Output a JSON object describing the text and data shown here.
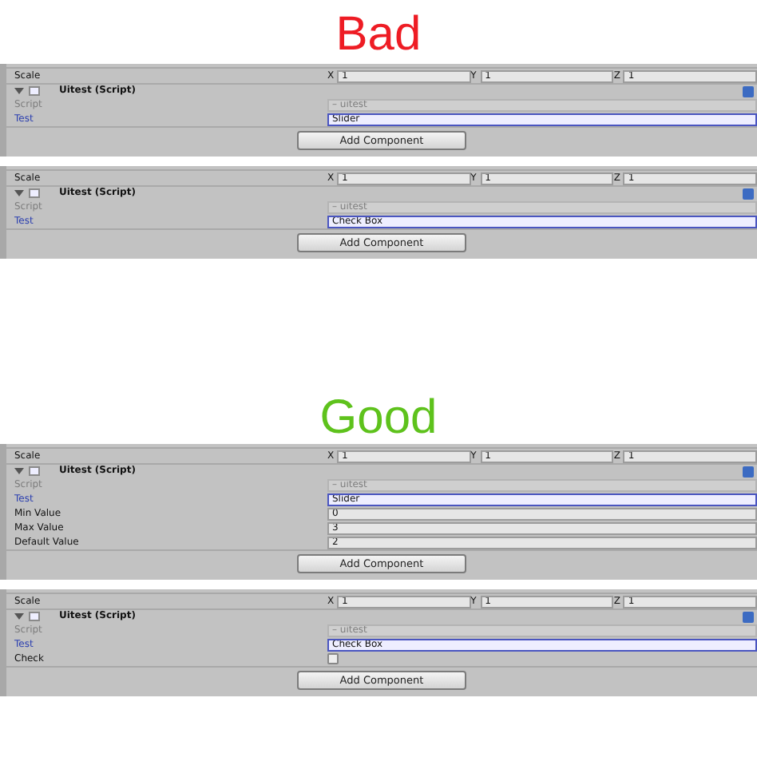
{
  "sections": [
    {
      "heading": "Bad",
      "color": "#ee1c24",
      "panels": [
        {
          "scale": {
            "label": "Scale",
            "fields": [
              {
                "axis": "X",
                "value": "1"
              },
              {
                "axis": "Y",
                "value": "1"
              },
              {
                "axis": "Z",
                "value": "1"
              }
            ]
          },
          "component": {
            "title": "Uitest (Script)",
            "expanded": true
          },
          "script": {
            "label": "Script",
            "value": "– uitest",
            "disabled": true
          },
          "test": {
            "label": "Test",
            "value": "Slider"
          },
          "button": "Add Component"
        },
        {
          "scale": {
            "label": "Scale",
            "fields": [
              {
                "axis": "X",
                "value": "1"
              },
              {
                "axis": "Y",
                "value": "1"
              },
              {
                "axis": "Z",
                "value": "1"
              }
            ]
          },
          "component": {
            "title": "Uitest (Script)",
            "expanded": true
          },
          "script": {
            "label": "Script",
            "value": "– uitest",
            "disabled": true
          },
          "test": {
            "label": "Test",
            "value": "Check Box"
          },
          "button": "Add Component"
        }
      ]
    },
    {
      "heading": "Good",
      "color": "#5ec21c",
      "panels": [
        {
          "scale": {
            "label": "Scale",
            "fields": [
              {
                "axis": "X",
                "value": "1"
              },
              {
                "axis": "Y",
                "value": "1"
              },
              {
                "axis": "Z",
                "value": "1"
              }
            ]
          },
          "component": {
            "title": "Uitest (Script)",
            "expanded": true
          },
          "script": {
            "label": "Script",
            "value": "– uitest",
            "disabled": true
          },
          "test": {
            "label": "Test",
            "value": "Slider"
          },
          "properties": [
            {
              "kind": "number",
              "label": "Min Value",
              "value": "0"
            },
            {
              "kind": "number",
              "label": "Max Value",
              "value": "3"
            },
            {
              "kind": "number",
              "label": "Default Value",
              "value": "2"
            }
          ],
          "button": "Add Component"
        },
        {
          "scale": {
            "label": "Scale",
            "fields": [
              {
                "axis": "X",
                "value": "1"
              },
              {
                "axis": "Y",
                "value": "1"
              },
              {
                "axis": "Z",
                "value": "1"
              }
            ]
          },
          "component": {
            "title": "Uitest (Script)",
            "expanded": true
          },
          "script": {
            "label": "Script",
            "value": "– uitest",
            "disabled": true
          },
          "test": {
            "label": "Test",
            "value": "Check Box"
          },
          "properties": [
            {
              "kind": "checkbox",
              "label": "Check",
              "checked": false
            }
          ],
          "button": "Add Component"
        }
      ]
    }
  ]
}
